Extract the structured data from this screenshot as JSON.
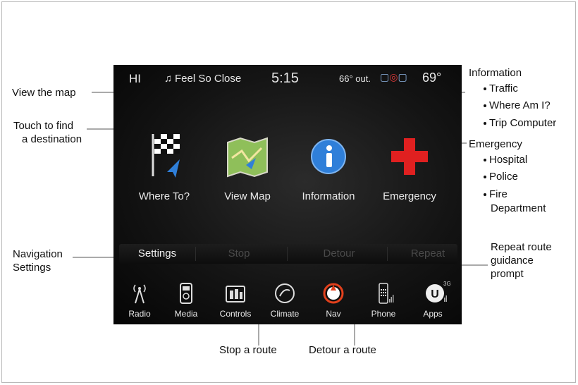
{
  "status_bar": {
    "radio": "HI",
    "song": "Feel So Close",
    "time": "5:15",
    "outside_temp": "66° out.",
    "inside_temp": "69°"
  },
  "main_buttons": [
    {
      "label": "Where To?",
      "icon": "checkered-flag-icon"
    },
    {
      "label": "View Map",
      "icon": "map-icon"
    },
    {
      "label": "Information",
      "icon": "info-icon"
    },
    {
      "label": "Emergency",
      "icon": "red-cross-icon"
    }
  ],
  "soft_keys": [
    {
      "label": "Settings",
      "enabled": true
    },
    {
      "label": "Stop",
      "enabled": false
    },
    {
      "label": "Detour",
      "enabled": false
    },
    {
      "label": "Repeat",
      "enabled": false
    }
  ],
  "dock": [
    {
      "label": "Radio",
      "icon": "radio-antenna-icon"
    },
    {
      "label": "Media",
      "icon": "media-icon"
    },
    {
      "label": "Controls",
      "icon": "controls-icon"
    },
    {
      "label": "Climate",
      "icon": "climate-icon"
    },
    {
      "label": "Nav",
      "icon": "nav-icon",
      "active": true
    },
    {
      "label": "Phone",
      "icon": "phone-icon"
    },
    {
      "label": "Apps",
      "icon": "apps-icon",
      "badge": "3G"
    }
  ],
  "callouts": {
    "view_map": "View the map",
    "find_destination_1": "Touch to find",
    "find_destination_2": "a destination",
    "navigation_settings_1": "Navigation",
    "navigation_settings_2": "Settings",
    "stop_route": "Stop a route",
    "detour_route": "Detour a route",
    "information_title": "Information",
    "information_items": [
      "Traffic",
      "Where Am I?",
      "Trip Computer"
    ],
    "emergency_title": "Emergency",
    "emergency_items": [
      "Hospital",
      "Police",
      "Fire"
    ],
    "emergency_item_cont": "Department",
    "repeat_1": "Repeat route",
    "repeat_2": "guidance",
    "repeat_3": "prompt"
  },
  "colors": {
    "screen_bg": "#141414",
    "info_blue": "#2f7fd9",
    "emergency_red": "#e02020",
    "nav_accent": "#e2401c"
  }
}
